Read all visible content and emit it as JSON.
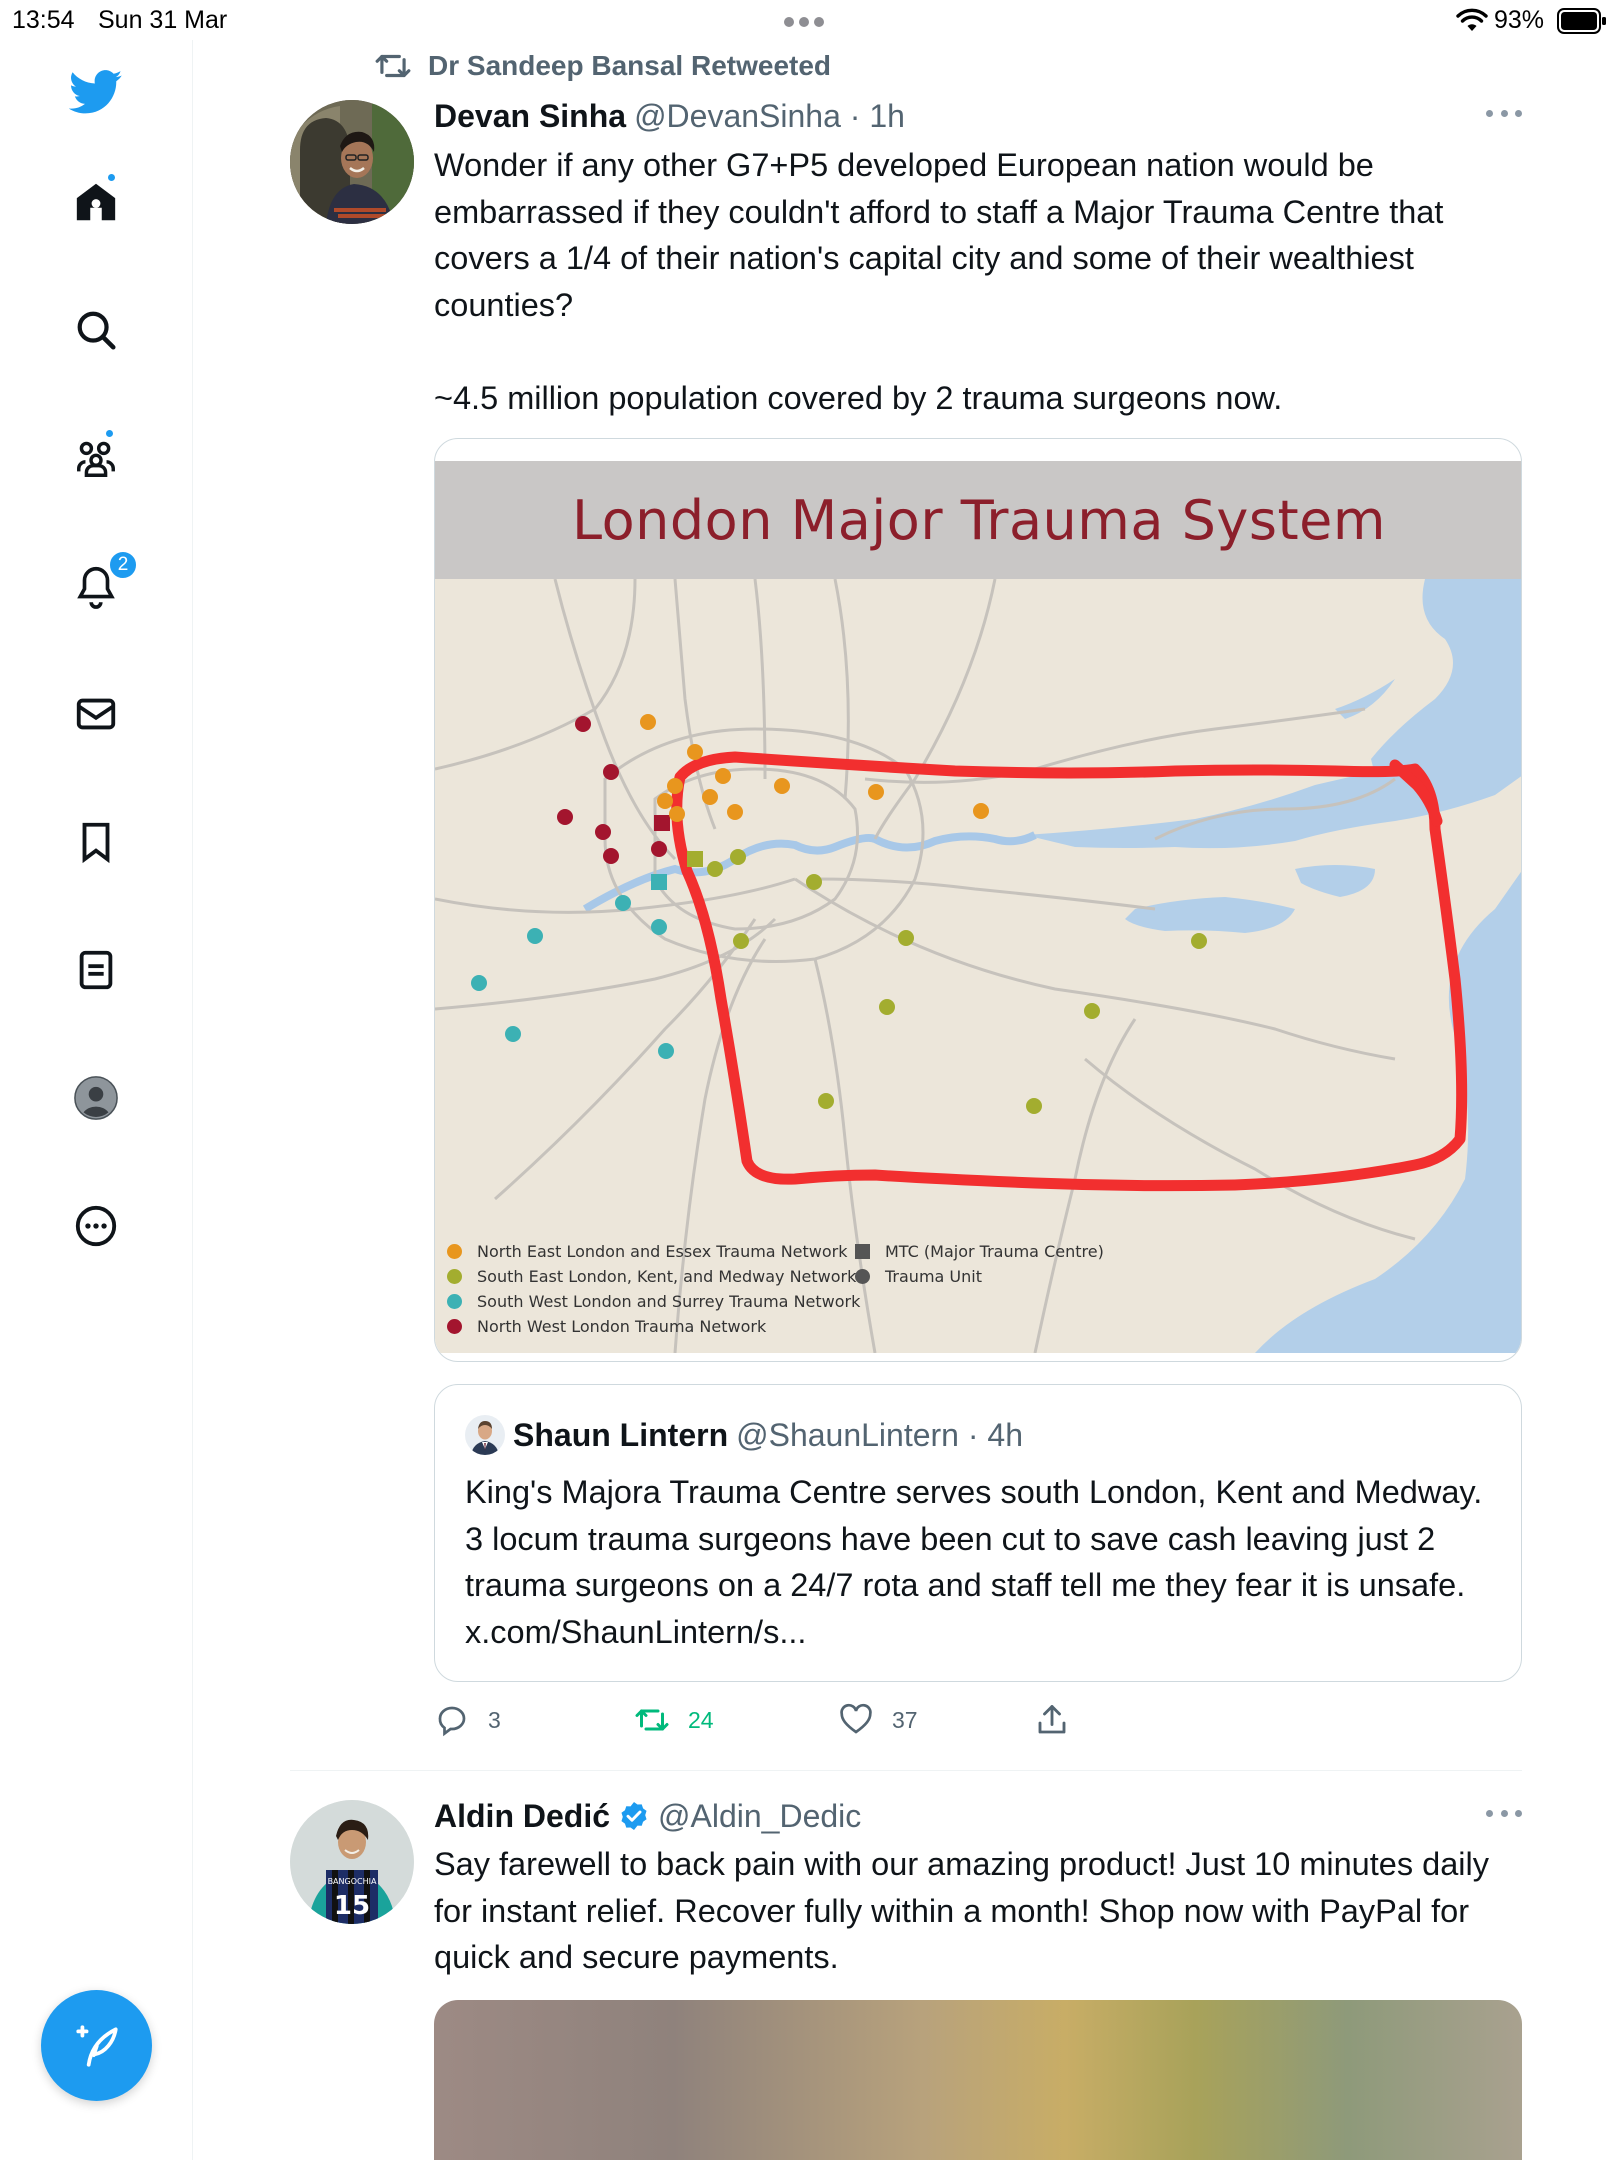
{
  "status_bar": {
    "time": "13:54",
    "date": "Sun 31 Mar",
    "battery": "93%"
  },
  "sidebar": {
    "items": [
      {
        "icon": "twitter-bird-icon"
      },
      {
        "icon": "home-icon",
        "has_dot": true
      },
      {
        "icon": "search-icon"
      },
      {
        "icon": "communities-icon",
        "has_dot": true
      },
      {
        "icon": "bell-icon",
        "badge": "2"
      },
      {
        "icon": "mail-icon"
      },
      {
        "icon": "bookmark-icon"
      },
      {
        "icon": "lists-icon"
      },
      {
        "icon": "profile-avatar-icon"
      },
      {
        "icon": "more-circle-icon"
      }
    ],
    "compose_icon": "compose-feather-icon"
  },
  "tweet1": {
    "retweeted_by": "Dr Sandeep Bansal Retweeted",
    "author_name": "Devan Sinha",
    "handle_time": "@DevanSinha · 1h",
    "text": "Wonder if any other G7+P5 developed European nation would be embarrassed if they couldn't afford to staff a Major Trauma Centre that covers a 1/4 of their nation's capital city and some of their wealthiest counties?\n\n~4.5 million population covered by 2 trauma surgeons now.",
    "map": {
      "title": "London Major Trauma System",
      "legend": [
        {
          "label": "North East London and Essex Trauma Network",
          "color": "#e8961e"
        },
        {
          "label": "South East London, Kent, and Medway Network",
          "color": "#a3ad2f"
        },
        {
          "label": "South West London and Surrey Trauma Network",
          "color": "#3cb1b4"
        },
        {
          "label": "North West London Trauma Network",
          "color": "#a3152e"
        },
        {
          "label": "MTC (Major Trauma Centre)",
          "shape": "square",
          "color": "#555555"
        },
        {
          "label": "Trauma Unit",
          "shape": "circle",
          "color": "#555555"
        }
      ]
    },
    "quote": {
      "author_name": "Shaun Lintern",
      "handle_time": "@ShaunLintern · 4h",
      "text": "King's Majora Trauma Centre serves south London, Kent and Medway. 3 locum trauma surgeons have been cut to save cash leaving just 2 trauma surgeons on a 24/7 rota and staff tell me they fear it is unsafe. x.com/ShaunLintern/s..."
    },
    "actions": {
      "replies": "3",
      "retweets": "24",
      "likes": "37"
    },
    "colors": {
      "retweet_active": "#00ba7c",
      "accent": "#1d9bf0"
    }
  },
  "tweet2": {
    "author_name": "Aldin Dedić",
    "handle": "@Aldin_Dedic",
    "text": "Say farewell to back pain with our amazing product! Just 10 minutes daily for instant relief. Recover fully within a month! Shop now with PayPal for quick and secure payments.",
    "avatar_jersey_text": "BANGOCHIA",
    "avatar_jersey_number": "15"
  }
}
